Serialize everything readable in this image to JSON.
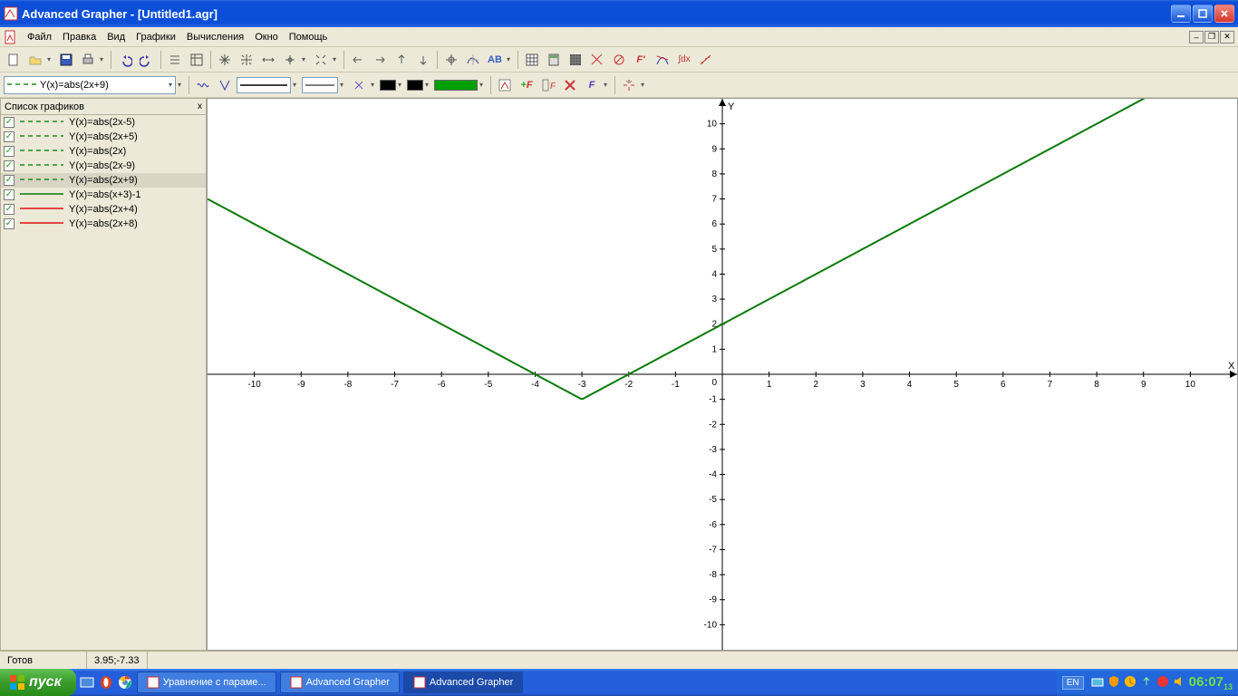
{
  "window": {
    "title": "Advanced Grapher - [Untitled1.agr]"
  },
  "menu": {
    "items": [
      "Файл",
      "Правка",
      "Вид",
      "Графики",
      "Вычисления",
      "Окно",
      "Помощь"
    ]
  },
  "plot_selector": {
    "label": "Y(x)=abs(2x+9)"
  },
  "side_panel": {
    "title": "Список графиков",
    "close": "x"
  },
  "graph_list": [
    {
      "label": "Y(x)=abs(2x-5)",
      "color": "#1a8c1a",
      "dash": true
    },
    {
      "label": "Y(x)=abs(2x+5)",
      "color": "#1a8c1a",
      "dash": true
    },
    {
      "label": "Y(x)=abs(2x)",
      "color": "#1a8c1a",
      "dash": true
    },
    {
      "label": "Y(x)=abs(2x-9)",
      "color": "#1a8c1a",
      "dash": true
    },
    {
      "label": "Y(x)=abs(2x+9)",
      "color": "#1a8c1a",
      "dash": true,
      "selected": true
    },
    {
      "label": "Y(x)=abs(x+3)-1",
      "color": "#0a7a0a",
      "dash": false
    },
    {
      "label": "Y(x)=abs(2x+4)",
      "color": "#e01010",
      "dash": false
    },
    {
      "label": "Y(x)=abs(2x+8)",
      "color": "#e01010",
      "dash": false
    }
  ],
  "status": {
    "ready": "Готов",
    "coords": "3.95;-7.33"
  },
  "taskbar": {
    "start": "пуск",
    "buttons": [
      {
        "label": "Уравнение с параме...",
        "active": false
      },
      {
        "label": "Advanced Grapher",
        "active": false
      },
      {
        "label": "Advanced Grapher",
        "active": true
      }
    ],
    "lang": "EN",
    "clock": "06:07",
    "clock_small": "13"
  },
  "colors": {
    "accent_green": "#00a000",
    "black": "#000000"
  },
  "chart_data": {
    "type": "line",
    "xlabel": "X",
    "ylabel": "Y",
    "xlim": [
      -11,
      11
    ],
    "ylim": [
      -11,
      11
    ],
    "xticks": [
      -10,
      -9,
      -8,
      -7,
      -6,
      -5,
      -4,
      -3,
      -2,
      -1,
      1,
      2,
      3,
      4,
      5,
      6,
      7,
      8,
      9,
      10
    ],
    "yticks": [
      -10,
      -9,
      -8,
      -7,
      -6,
      -5,
      -4,
      -3,
      -2,
      -1,
      1,
      2,
      3,
      4,
      5,
      6,
      7,
      8,
      9,
      10
    ],
    "series": [
      {
        "name": "Y(x)=abs(2x-5)",
        "color": "#1a8c1a",
        "dash": true,
        "expr": "abs(2*x-5)"
      },
      {
        "name": "Y(x)=abs(2x+5)",
        "color": "#1a8c1a",
        "dash": true,
        "expr": "abs(2*x+5)"
      },
      {
        "name": "Y(x)=abs(2x)",
        "color": "#1a8c1a",
        "dash": true,
        "expr": "abs(2*x)"
      },
      {
        "name": "Y(x)=abs(2x-9)",
        "color": "#1a8c1a",
        "dash": true,
        "expr": "abs(2*x-9)"
      },
      {
        "name": "Y(x)=abs(2x+9)",
        "color": "#1a8c1a",
        "dash": true,
        "expr": "abs(2*x+9)"
      },
      {
        "name": "Y(x)=abs(x+3)-1",
        "color": "#0a7a0a",
        "dash": false,
        "expr": "abs(x+3)-1"
      },
      {
        "name": "Y(x)=abs(2x+4)",
        "color": "#e01010",
        "dash": false,
        "expr": "abs(2*x+4)"
      },
      {
        "name": "Y(x)=abs(2x+8)",
        "color": "#e01010",
        "dash": false,
        "expr": "abs(2*x+8)"
      }
    ]
  }
}
